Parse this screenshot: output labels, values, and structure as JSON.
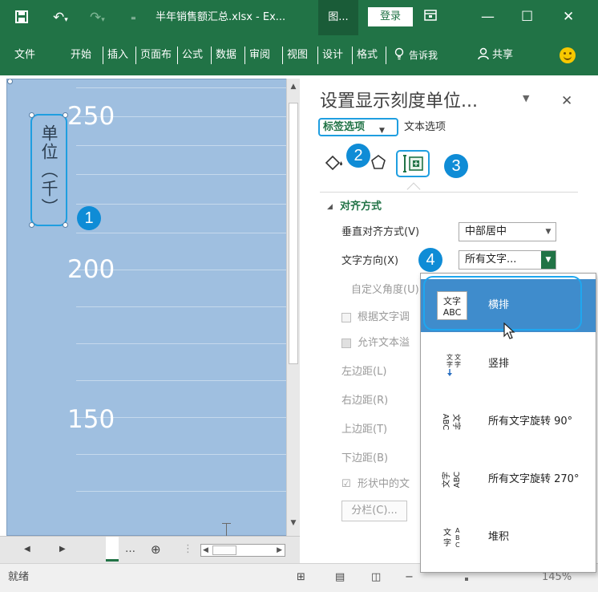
{
  "titlebar": {
    "filename": "半年销售额汇总.xlsx - Ex...",
    "context_tab": "图...",
    "login": "登录"
  },
  "ribbon": {
    "tabs": [
      "文件",
      "开始",
      "插入",
      "页面布",
      "公式",
      "数据",
      "审阅",
      "视图",
      "设计",
      "格式"
    ],
    "tellme": "告诉我",
    "share": "共享"
  },
  "chart": {
    "axis_labels": [
      "250",
      "200",
      "150"
    ],
    "unit_title": "单位（千）"
  },
  "callouts": [
    "1",
    "2",
    "3",
    "4"
  ],
  "pane": {
    "title": "设置显示刻度单位...",
    "tab_label_options": "标签选项",
    "tab_text_options": "文本选项",
    "section_alignment": "对齐方式",
    "vertical_align_label": "垂直对齐方式(V)",
    "vertical_align_value": "中部居中",
    "text_direction_label": "文字方向(X)",
    "text_direction_value": "所有文字...",
    "custom_angle_label": "自定义角度(U)",
    "resize_shape_label": "根据文字调",
    "allow_overflow_label": "允许文本溢",
    "left_margin_label": "左边距(L)",
    "right_margin_label": "右边距(R)",
    "top_margin_label": "上边距(T)",
    "bottom_margin_label": "下边距(B)",
    "wrap_text_label": "形状中的文",
    "columns_button": "分栏(C)..."
  },
  "text_direction_menu": [
    {
      "label": "横排",
      "selected": true,
      "icon": "horizontal-text-icon"
    },
    {
      "label": "竖排",
      "selected": false,
      "icon": "vertical-text-icon"
    },
    {
      "label": "所有文字旋转 90°",
      "selected": false,
      "icon": "rotate-90-text-icon"
    },
    {
      "label": "所有文字旋转 270°",
      "selected": false,
      "icon": "rotate-270-text-icon"
    },
    {
      "label": "堆积",
      "selected": false,
      "icon": "stacked-text-icon"
    }
  ],
  "statusbar": {
    "ready": "就绪",
    "zoom": "145%"
  },
  "colors": {
    "excel_green": "#217346",
    "chart_fill": "#9fbfe0",
    "callout_blue": "#0f8cd6",
    "menu_selected": "#3f8ccc"
  }
}
